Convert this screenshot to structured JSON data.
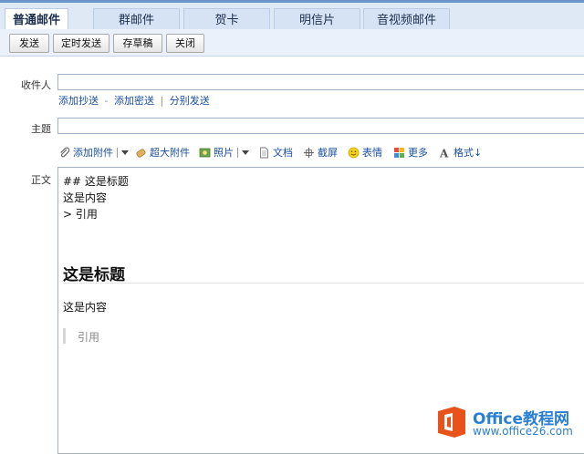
{
  "tabs": [
    {
      "label": "普通邮件",
      "active": true
    },
    {
      "label": "群邮件",
      "active": false
    },
    {
      "label": "贺卡",
      "active": false
    },
    {
      "label": "明信片",
      "active": false
    },
    {
      "label": "音视频邮件",
      "active": false
    }
  ],
  "toolbar": {
    "send_label": "发送",
    "scheduled_send_label": "定时发送",
    "save_draft_label": "存草稿",
    "close_label": "关闭"
  },
  "form": {
    "to_label": "收件人",
    "to_value": "",
    "add_cc_label": "添加抄送",
    "dash": "-",
    "add_bcc_label": "添加密送",
    "pipe": "|",
    "separate_send_label": "分别发送",
    "subject_label": "主题",
    "subject_value": "",
    "body_label": "正文"
  },
  "attachments": {
    "add_attachment_label": "添加附件",
    "large_attachment_label": "超大附件",
    "photo_label": "照片",
    "document_label": "文档",
    "screenshot_label": "截屏",
    "emoji_label": "表情",
    "more_label": "更多",
    "format_label": "格式↓",
    "icons": [
      "paperclip-icon",
      "large-attachment-icon",
      "photo-icon",
      "document-icon",
      "screenshot-icon",
      "emoji-icon",
      "more-icon",
      "format-icon"
    ]
  },
  "editor": {
    "markdown_lines": [
      "## 这是标题",
      "这是内容",
      "> 引用"
    ],
    "rendered_heading": "这是标题",
    "rendered_paragraph": "这是内容",
    "rendered_quote": "引用"
  },
  "watermark": {
    "line1": "Office教程网",
    "line2": "www.office26.com",
    "logo_color": "#e8531c",
    "text_color": "#2a7fd4"
  },
  "colors": {
    "tab_bar_bg": "#dfe9f6",
    "toolbar_bg": "#eaf1fa",
    "link": "#1a4fa0"
  }
}
